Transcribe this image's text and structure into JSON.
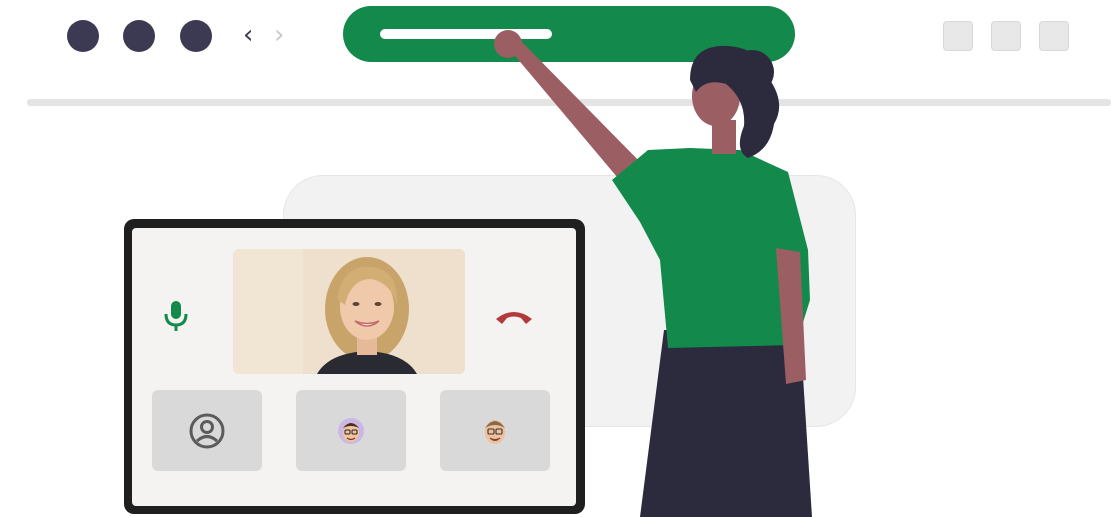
{
  "window": {
    "controls": [
      "close-dot",
      "minimize-dot",
      "maximize-dot"
    ],
    "back_glyph": "‹",
    "forward_glyph": "›"
  },
  "colors": {
    "brand_green": "#138a4b",
    "dark_navy": "#3b3a52",
    "hangup_red": "#b23a3a",
    "card_bg": "#f2f2f2"
  },
  "call": {
    "icons": {
      "mic": "microphone-icon",
      "hangup": "phone-hangup-icon",
      "user": "user-circle-icon"
    },
    "participants": [
      {
        "type": "user-icon"
      },
      {
        "type": "avatar"
      },
      {
        "type": "avatar"
      }
    ]
  }
}
